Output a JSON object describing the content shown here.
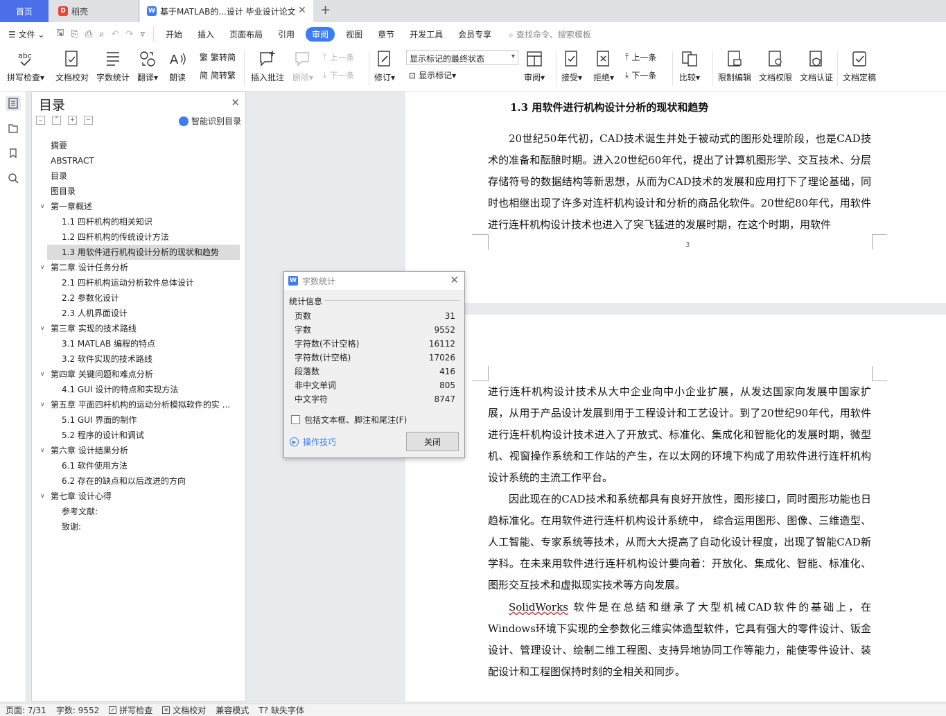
{
  "tabs": {
    "home": "首页",
    "daoke": "稻壳",
    "document": "基于MATLAB的...设计 毕业设计论文"
  },
  "menu": {
    "file": "文件",
    "items": [
      "开始",
      "插入",
      "页面布局",
      "引用",
      "审阅",
      "视图",
      "章节",
      "开发工具",
      "会员专享"
    ],
    "search_placeholder": "查找命令、搜索模板"
  },
  "ribbon": {
    "spellcheck": "拼写检查",
    "doc_proof": "文档校对",
    "word_count": "字数统计",
    "translate": "翻译",
    "read_aloud": "朗读",
    "trad_to_simp": "繁转简",
    "simp_to_trad": "简转繁",
    "insert_comment": "插入批注",
    "delete": "删除",
    "prev_comment": "上一条",
    "next_comment": "下一条",
    "track_changes": "修订",
    "markup_state": "显示标记的最终状态",
    "show_markup": "显示标记",
    "review": "审阅",
    "accept": "接受",
    "reject": "拒绝",
    "prev_change": "上一条",
    "next_change": "下一条",
    "compare": "比较",
    "restrict_edit": "限制编辑",
    "doc_permission": "文档权限",
    "doc_certify": "文档认证",
    "doc_finalize": "文档定稿"
  },
  "toc": {
    "title": "目录",
    "smart_button": "智能识别目录",
    "items": [
      {
        "text": "摘要",
        "level": 0
      },
      {
        "text": "ABSTRACT",
        "level": 0
      },
      {
        "text": "目录",
        "level": 0
      },
      {
        "text": "图目录",
        "level": 0
      },
      {
        "text": "第一章概述",
        "level": 1
      },
      {
        "text": "1.1  四杆机构的相关知识",
        "level": 2
      },
      {
        "text": "1.2  四杆机构的传统设计方法",
        "level": 2
      },
      {
        "text": "1.3  用软件进行机构设计分析的现状和趋势",
        "level": 2,
        "active": true
      },
      {
        "text": "第二章  设计任务分析",
        "level": 1
      },
      {
        "text": "2.1  四杆机构运动分析软件总体设计",
        "level": 2
      },
      {
        "text": "2.2  参数化设计",
        "level": 2
      },
      {
        "text": "2.3  人机界面设计",
        "level": 2
      },
      {
        "text": "第三章  实现的技术路线",
        "level": 1
      },
      {
        "text": "3.1 MATLAB 编程的特点",
        "level": 2
      },
      {
        "text": "3.2  软件实现的技术路线",
        "level": 2
      },
      {
        "text": "第四章  关键问题和难点分析",
        "level": 1
      },
      {
        "text": "4.1 GUI 设计的特点和实现方法",
        "level": 2
      },
      {
        "text": "第五章  平面四杆机构的运动分析模拟软件的实 ...",
        "level": 1
      },
      {
        "text": "5.1 GUI 界面的制作",
        "level": 2
      },
      {
        "text": "5.2 程序的设计和调试",
        "level": 2
      },
      {
        "text": "第六章  设计结果分析",
        "level": 1
      },
      {
        "text": "6.1 软件使用方法",
        "level": 2
      },
      {
        "text": "6.2 存在的缺点和以后改进的方向",
        "level": 2
      },
      {
        "text": "第七章  设计心得",
        "level": 1
      },
      {
        "text": "参考文献:",
        "level": 2
      },
      {
        "text": "致谢:",
        "level": 2
      }
    ]
  },
  "document": {
    "heading": "1.3 用软件进行机构设计分析的现状和趋势",
    "page1_text": "20世纪50年代初，CAD技术诞生并处于被动式的图形处理阶段，也是CAD技术的准备和酝酿时期。进入20世纪60年代，提出了计算机图形学、交互技术、分层存储符号的数据结构等新思想，从而为CAD技术的发展和应用打下了理论基础，同时也相继出现了许多对连杆机构设计和分析的商品化软件。20世纪80年代，用软件进行连杆机构设计技术也进入了突飞猛进的发展时期，在这个时期，用软件",
    "page_number": "3",
    "page2_para1": "进行连杆机构设计技术从大中企业向中小企业扩展，从发达国家向发展中国家扩展，从用于产品设计发展到用于工程设计和工艺设计。到了20世纪90年代，用软件进行连杆机构设计技术进入了开放式、标准化、集成化和智能化的发展时期，微型机、视窗操作系统和工作站的产生，在以太网的环境下构成了用软件进行连杆机构设计系统的主流工作平台。",
    "page2_para2": "因此现在的CAD技术和系统都具有良好开放性，图形接口，同时图形功能也日趋标准化。在用软件进行连杆机构设计系统中， 综合运用图形、图像、三维造型、人工智能、专家系统等技术，从而大大提高了自动化设计程度，出现了智能CAD新学科。在未来用软件进行连杆机构设计要向着：开放化、集成化、智能、标准化、图形交互技术和虚拟现实技术等方向发展。",
    "page2_para3_word": "SolidWorks",
    "page2_para3_rest": " 软件是在总结和继承了大型机械CAD软件的基础上，在Windows环境下实现的全参数化三维实体造型软件，它具有强大的零件设计、钣金设计、管理设计、绘制二维工程图、支持异地协同工作等能力，能使零件设计、装配设计和工程图保持时刻的全相关和同步。"
  },
  "dialog": {
    "title": "字数统计",
    "section": "统计信息",
    "stats": [
      {
        "label": "页数",
        "value": "31"
      },
      {
        "label": "字数",
        "value": "9552"
      },
      {
        "label": "字符数(不计空格)",
        "value": "16112"
      },
      {
        "label": "字符数(计空格)",
        "value": "17026"
      },
      {
        "label": "段落数",
        "value": "416"
      },
      {
        "label": "非中文单词",
        "value": "805"
      },
      {
        "label": "中文字符",
        "value": "8747"
      }
    ],
    "include_label": "包括文本框、脚注和尾注(F)",
    "include_checked": false,
    "tips": "操作技巧",
    "close": "关闭"
  },
  "statusbar": {
    "page": "页面: 7/31",
    "words": "字数: 9552",
    "spellcheck": "拼写检查",
    "proof": "文档校对",
    "compat": "兼容模式",
    "missing_font": "缺失字体"
  },
  "colors": {
    "accent": "#3d7cf4",
    "home_tab": "#4a6fe8"
  }
}
